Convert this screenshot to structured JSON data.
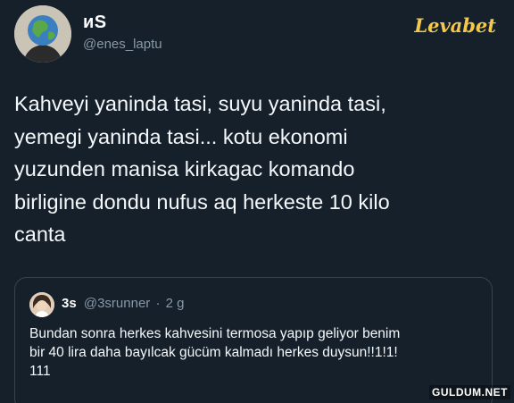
{
  "author": {
    "display_name": "ᴎS",
    "handle": "@enes_laptu"
  },
  "watermark_top": "Levabet",
  "tweet": {
    "lines": [
      "Kahveyi yaninda tasi, suyu yaninda tasi,",
      "yemegi yaninda tasi... kotu ekonomi",
      "yuzunden manisa kirkagac komando",
      "birligine dondu nufus aq herkeste 10 kilo",
      "canta"
    ]
  },
  "quote": {
    "name": "3s",
    "handle": "@3srunner",
    "separator": "·",
    "time": "2 g",
    "lines": [
      "Bundan sonra herkes kahvesini termosa yapıp geliyor benim",
      "bir 40 lira daha bayılcak gücüm kalmadı herkes duysun!!1!1!",
      "111"
    ]
  },
  "watermark_bottom": "GULDUM.NET",
  "colors": {
    "background": "#15202b",
    "text": "#f5f8fa",
    "secondary": "#8899a6",
    "border": "#38444d"
  }
}
